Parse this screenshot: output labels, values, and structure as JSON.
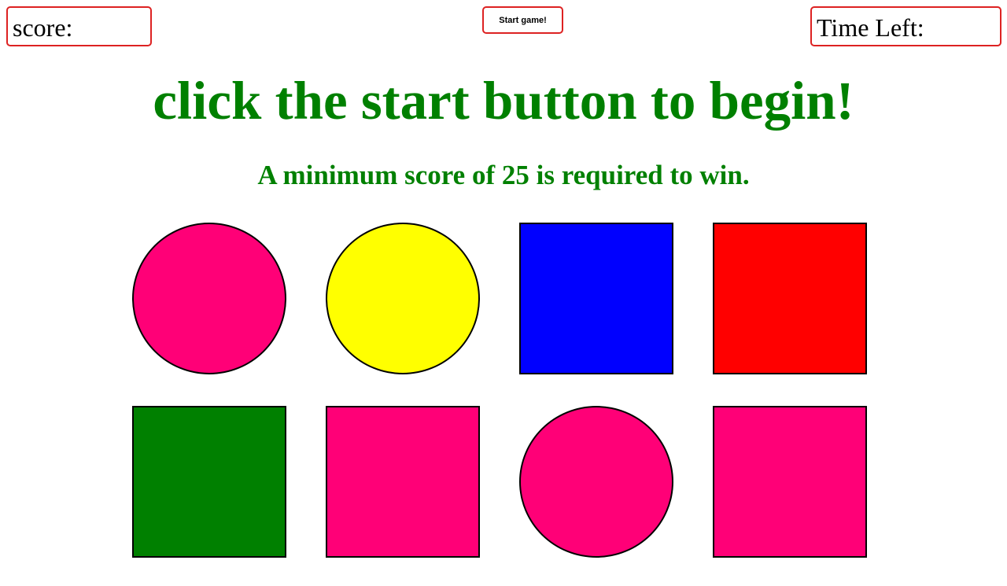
{
  "header": {
    "score_label": "score:",
    "start_label": "Start game!",
    "time_label": "Time Left:"
  },
  "message": {
    "headline": "click the start button to begin!",
    "subline": "A minimum score of 25 is required to win."
  },
  "colors": {
    "message_text": "#008000",
    "box_border": "#dd2222"
  },
  "shapes": [
    {
      "kind": "circle",
      "color": "#ff0077"
    },
    {
      "kind": "circle",
      "color": "#ffff00"
    },
    {
      "kind": "square",
      "color": "#0000ff"
    },
    {
      "kind": "square",
      "color": "#ff0000"
    },
    {
      "kind": "square",
      "color": "#008000"
    },
    {
      "kind": "square",
      "color": "#ff0077"
    },
    {
      "kind": "circle",
      "color": "#ff0077"
    },
    {
      "kind": "square",
      "color": "#ff0077"
    }
  ]
}
